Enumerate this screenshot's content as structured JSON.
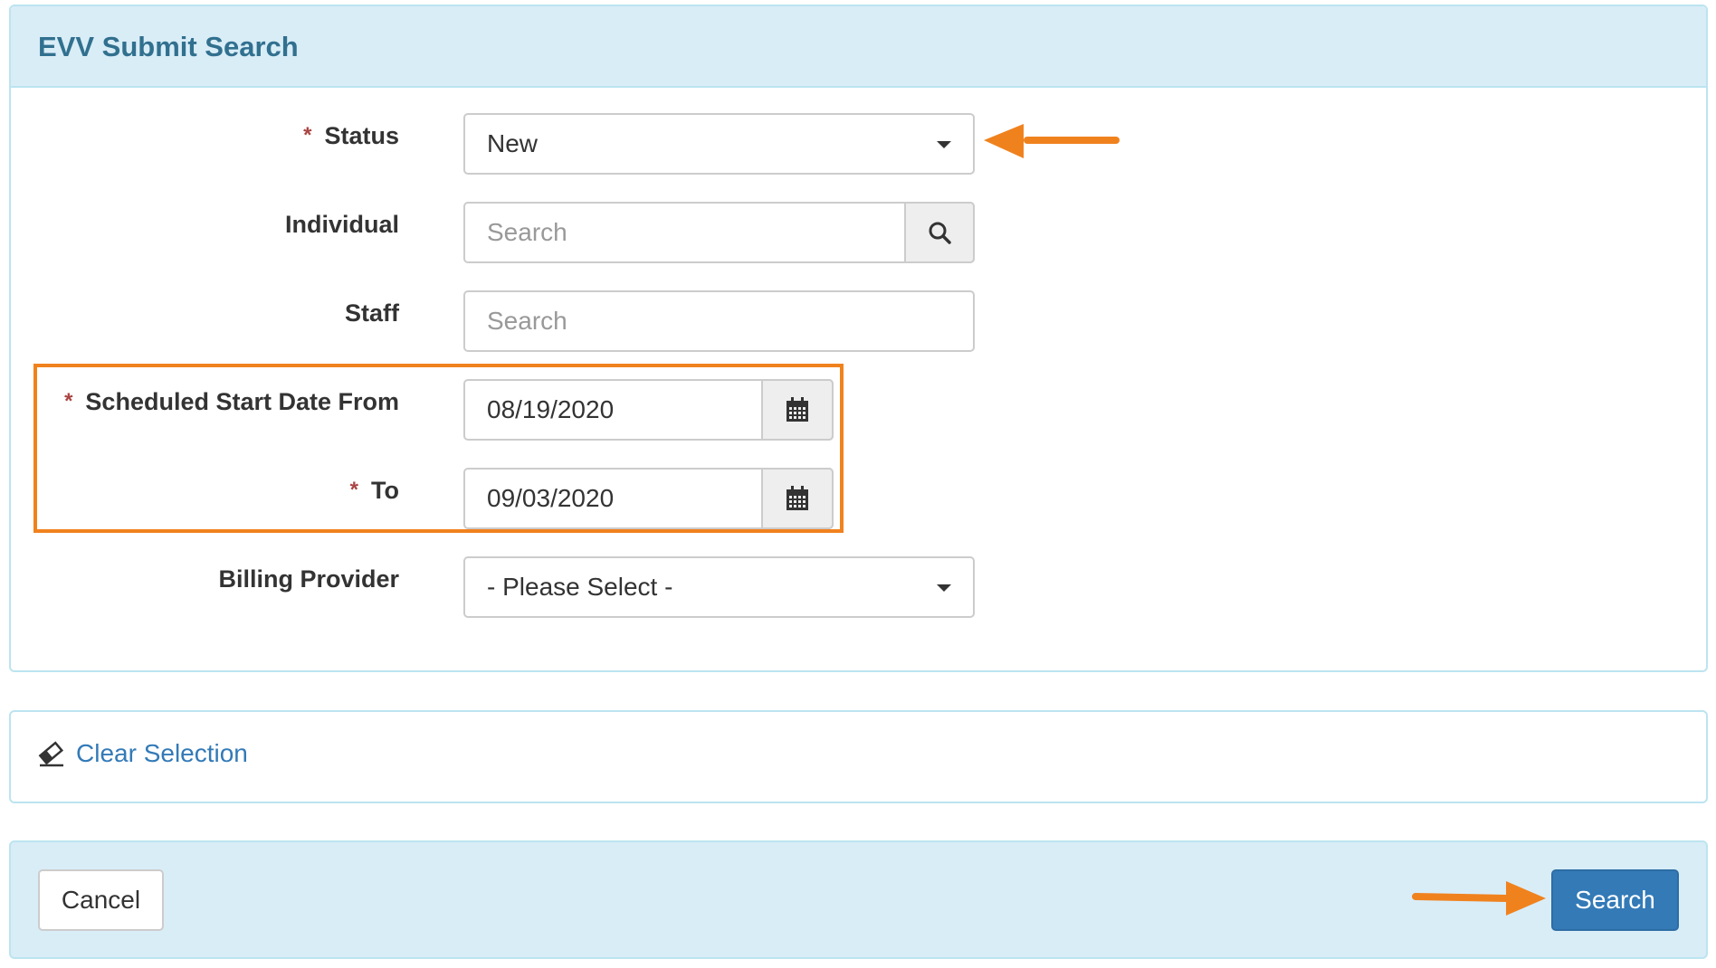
{
  "panel": {
    "title": "EVV Submit Search"
  },
  "fields": {
    "status": {
      "label": "Status",
      "required_mark": "*",
      "value": "New"
    },
    "individual": {
      "label": "Individual",
      "placeholder": "Search"
    },
    "staff": {
      "label": "Staff",
      "placeholder": "Search"
    },
    "start_from": {
      "label": "Scheduled Start Date From",
      "required_mark": "*",
      "value": "08/19/2020"
    },
    "start_to": {
      "label": "To",
      "required_mark": "*",
      "value": "09/03/2020"
    },
    "billing_provider": {
      "label": "Billing Provider",
      "value": "- Please Select -"
    }
  },
  "clear": {
    "label": "Clear Selection"
  },
  "footer": {
    "cancel_label": "Cancel",
    "search_label": "Search"
  },
  "icons": {
    "search": "search-icon",
    "calendar": "calendar-icon",
    "eraser": "eraser-icon",
    "caret": "caret-down-icon",
    "annotation_arrow": "arrow-icon"
  },
  "colors": {
    "heading_bg": "#d9edf7",
    "heading_text": "#31708f",
    "required": "#a94442",
    "link": "#337ab7",
    "primary_button": "#337ab7",
    "annotation": "#f0821e"
  }
}
